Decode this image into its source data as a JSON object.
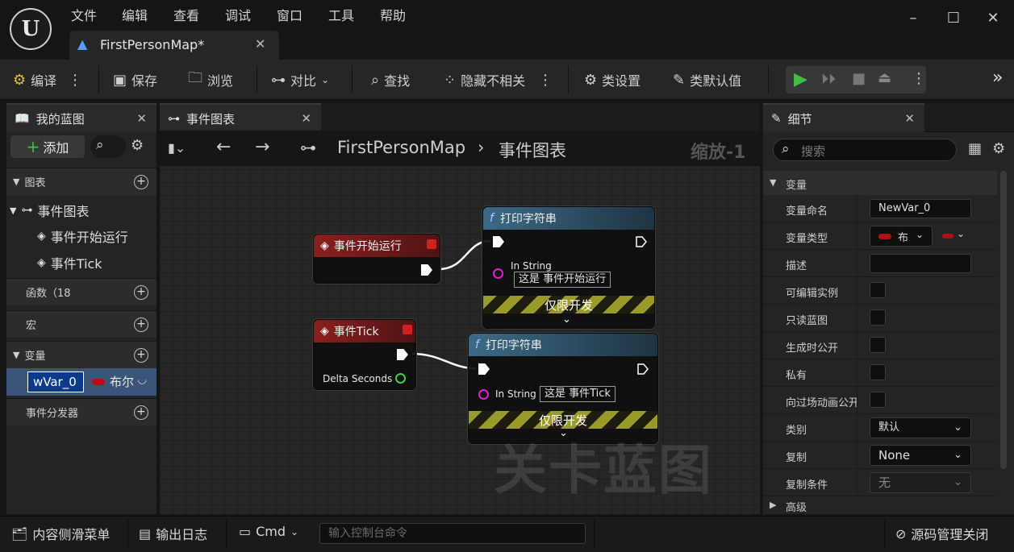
{
  "menu": [
    "文件",
    "编辑",
    "查看",
    "调试",
    "窗口",
    "工具",
    "帮助"
  ],
  "document_tab": {
    "title": "FirstPersonMap*"
  },
  "logo_text": "U",
  "toolbar": {
    "compile": "编译",
    "save": "保存",
    "browse": "浏览",
    "diff": "对比",
    "find": "查找",
    "hide_unrelated": "隐藏不相关",
    "class_settings": "类设置",
    "class_defaults": "类默认值"
  },
  "my_blueprint": {
    "tab": "我的蓝图",
    "add_button": "添加",
    "sections": {
      "graphs": "图表",
      "functions": "函数（18",
      "macros": "宏",
      "variables": "变量",
      "event_dispatchers": "事件分发器"
    },
    "graph_items": [
      "事件图表",
      "事件开始运行",
      "事件Tick"
    ],
    "variable": {
      "name": "wVar_0",
      "type": "布尔"
    }
  },
  "graph_panel": {
    "tab": "事件图表",
    "breadcrumb_root": "FirstPersonMap",
    "breadcrumb_leaf": "事件图表",
    "zoom": "缩放-1",
    "watermark": "关卡蓝图"
  },
  "nodes": {
    "begin_play": {
      "title": "事件开始运行"
    },
    "tick": {
      "title": "事件Tick",
      "pin": "Delta Seconds"
    },
    "print1": {
      "title": "打印字符串",
      "in_label": "In String",
      "value": "这是 事件开始运行",
      "dev": "仅限开发"
    },
    "print2": {
      "title": "打印字符串",
      "in_label": "In String",
      "value": "这是 事件Tick",
      "dev": "仅限开发"
    }
  },
  "details": {
    "tab": "细节",
    "search_placeholder": "搜索",
    "category": "变量",
    "rows": {
      "var_name_label": "变量命名",
      "var_name_value": "NewVar_0",
      "var_type_label": "变量类型",
      "var_type_value": "布",
      "desc_label": "描述",
      "editable_label": "可编辑实例",
      "readonly_label": "只读蓝图",
      "expose_spawn_label": "生成时公开",
      "private_label": "私有",
      "expose_cine_label": "向过场动画公开",
      "category_label": "类别",
      "category_value": "默认",
      "replication_label": "复制",
      "replication_value": "None",
      "rep_cond_label": "复制条件",
      "rep_cond_value": "无"
    },
    "advanced": "高级"
  },
  "bottom": {
    "content_drawer": "内容侧滑菜单",
    "output_log": "输出日志",
    "cmd": "Cmd",
    "cmd_placeholder": "输入控制台命令",
    "source_control": "源码管理关闭"
  },
  "colors": {
    "exec_red": "#8b1f1f",
    "func_blue": "#3d6a87",
    "play_green": "#3fbf3f",
    "bool_red": "#b01010"
  }
}
